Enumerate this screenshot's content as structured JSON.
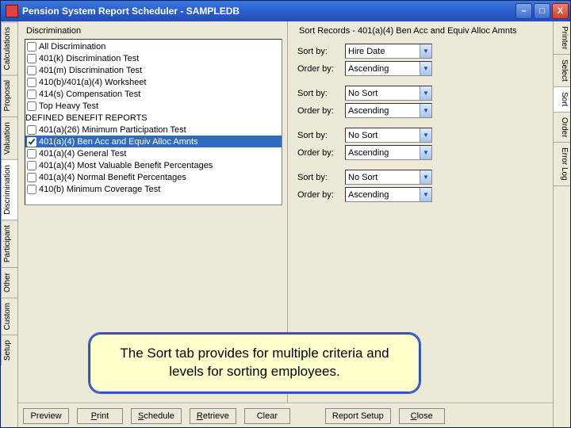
{
  "window": {
    "title": "Pension System Report Scheduler - SAMPLEDB"
  },
  "titlebtns": {
    "min": "–",
    "max": "□",
    "close": "X"
  },
  "leftTabs": [
    "Calculations",
    "Proposal",
    "Valuation",
    "Discrimination",
    "Participant",
    "Other",
    "Custom",
    "Setup"
  ],
  "rightTabs": [
    "Printer",
    "Select",
    "Sort",
    "Order",
    "Error Log"
  ],
  "leftPanel": {
    "label": "Discrimination",
    "items": [
      {
        "c": 0,
        "t": "All Discrimination"
      },
      {
        "c": 0,
        "t": "401(k) Discrimination Test"
      },
      {
        "c": 0,
        "t": "401(m) Discrimination Test"
      },
      {
        "c": 0,
        "t": "410(b)/401(a)(4) Worksheet"
      },
      {
        "c": 0,
        "t": "414(s) Compensation Test"
      },
      {
        "c": 0,
        "t": "Top Heavy Test"
      },
      {
        "nocheck": 1,
        "t": "  DEFINED BENEFIT REPORTS"
      },
      {
        "c": 0,
        "t": "401(a)(26) Minimum Participation Test"
      },
      {
        "c": 1,
        "sel": 1,
        "t": "401(a)(4) Ben Acc and Equiv Alloc Amnts"
      },
      {
        "c": 0,
        "t": "401(a)(4) General Test"
      },
      {
        "c": 0,
        "t": "401(a)(4) Most Valuable Benefit Percentages"
      },
      {
        "c": 0,
        "t": "401(a)(4) Normal Benefit Percentages"
      },
      {
        "c": 0,
        "t": "410(b) Minimum Coverage Test"
      }
    ]
  },
  "rightPanel": {
    "label": "Sort Records - 401(a)(4) Ben Acc and Equiv Alloc Amnts",
    "rows": [
      {
        "l": "Sort by:",
        "v": "Hire Date"
      },
      {
        "l": "Order by:",
        "v": "Ascending"
      },
      {
        "l": "Sort by:",
        "v": "No Sort"
      },
      {
        "l": "Order by:",
        "v": "Ascending"
      },
      {
        "l": "Sort by:",
        "v": "No Sort"
      },
      {
        "l": "Order by:",
        "v": "Ascending"
      },
      {
        "l": "Sort by:",
        "v": "No Sort"
      },
      {
        "l": "Order by:",
        "v": "Ascending"
      }
    ]
  },
  "buttons": {
    "preview": "Preview",
    "print": "Print",
    "schedule": "Schedule",
    "retrieve": "Retrieve",
    "clear": "Clear",
    "reportsetup": "Report Setup",
    "close": "Close"
  },
  "callout": "The Sort tab provides for multiple criteria and levels for sorting employees."
}
